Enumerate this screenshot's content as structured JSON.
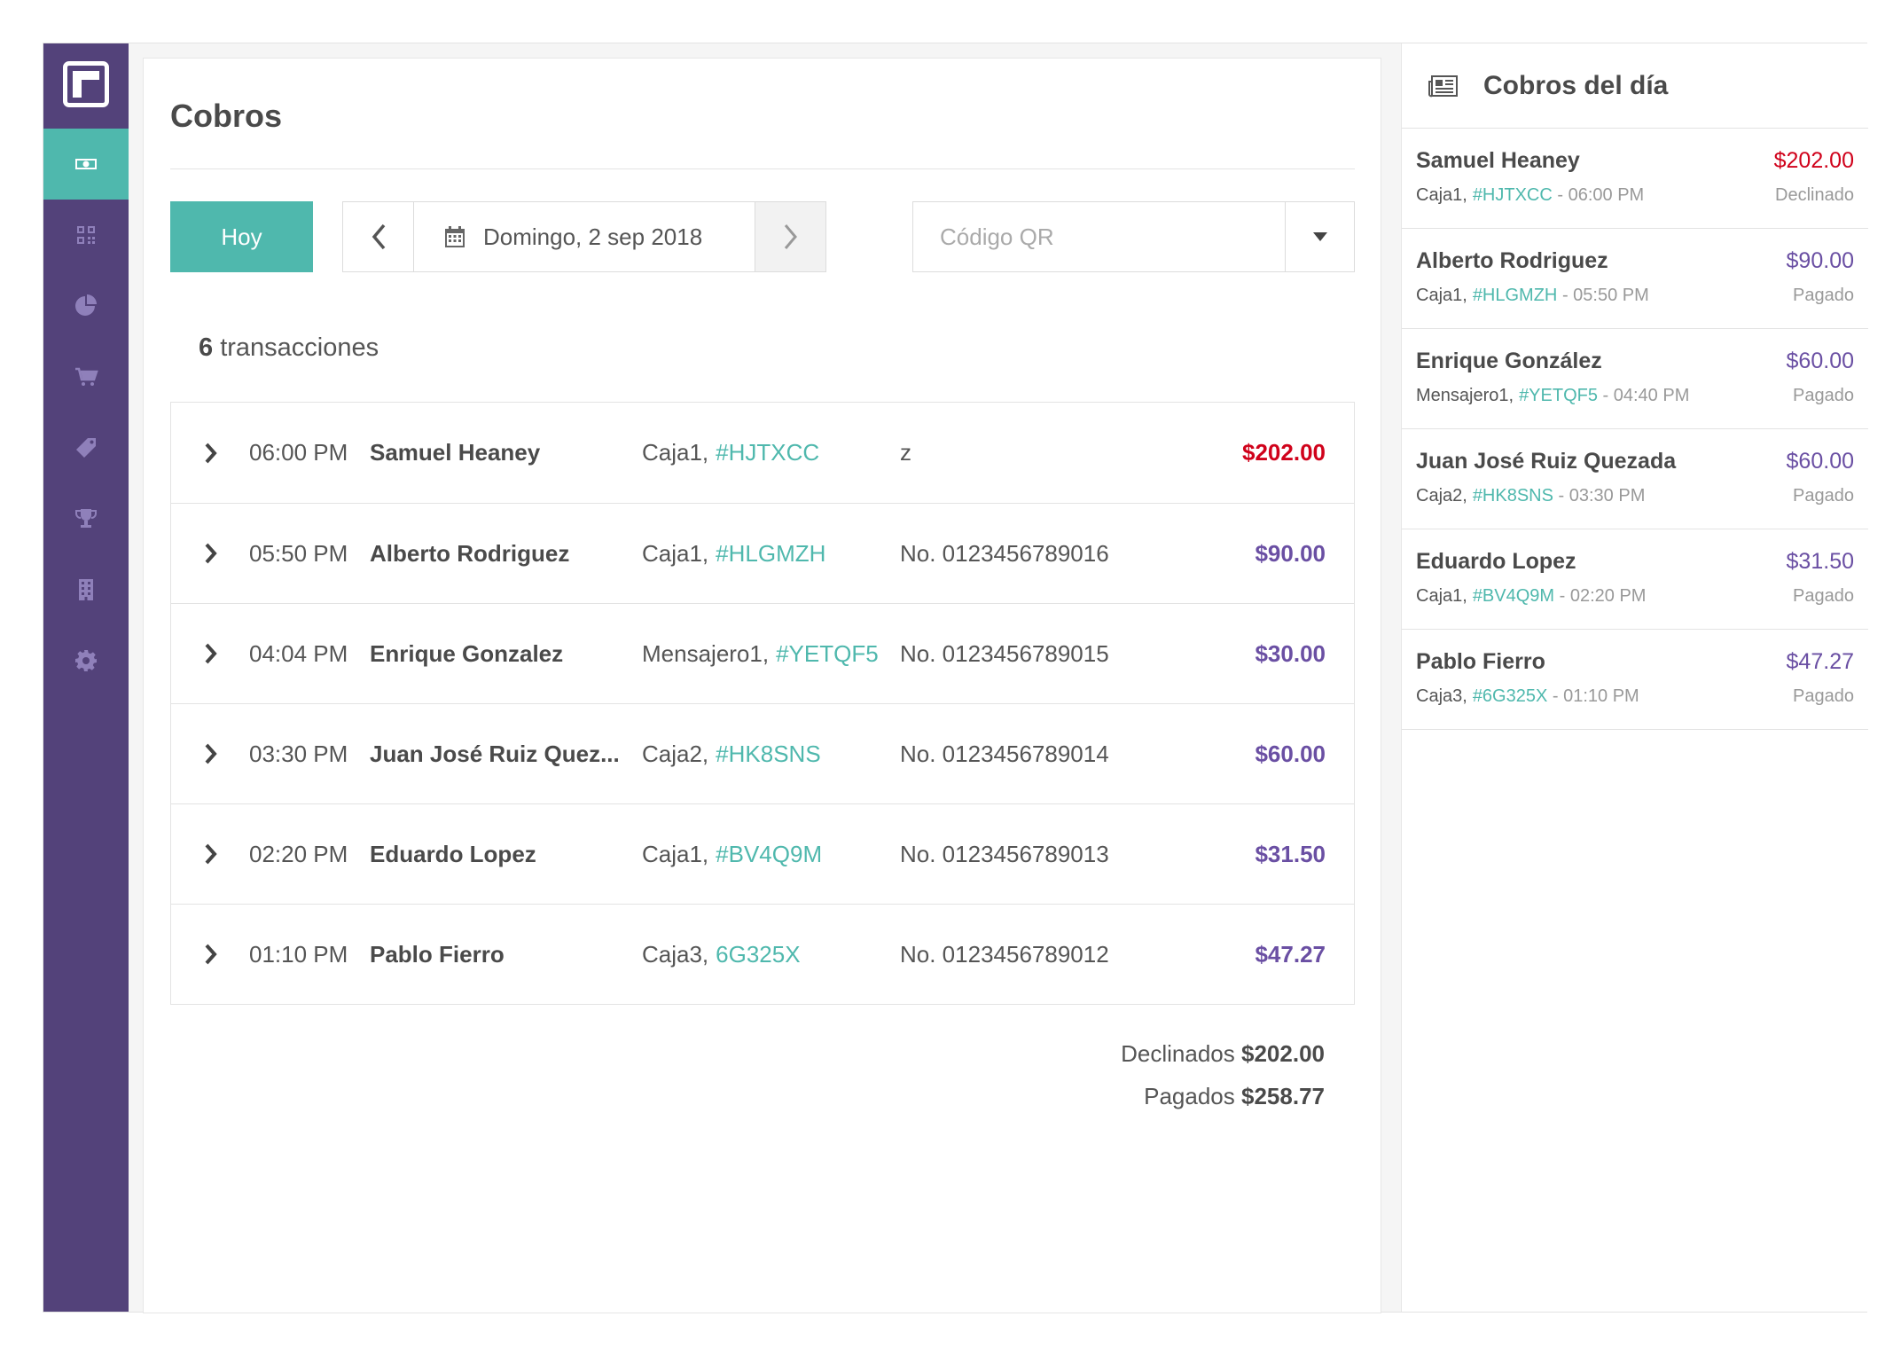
{
  "sidebar": {
    "items": [
      {
        "icon": "money-icon",
        "active": true
      },
      {
        "icon": "qr-code-icon",
        "active": false
      },
      {
        "icon": "pie-chart-icon",
        "active": false
      },
      {
        "icon": "cart-icon",
        "active": false
      },
      {
        "icon": "tag-icon",
        "active": false
      },
      {
        "icon": "trophy-icon",
        "active": false
      },
      {
        "icon": "building-icon",
        "active": false
      },
      {
        "icon": "gear-icon",
        "active": false
      }
    ]
  },
  "main": {
    "title": "Cobros",
    "today_button": "Hoy",
    "date_label": "Domingo, 2 sep 2018",
    "qr_placeholder": "Código QR",
    "tx_count_number": "6",
    "tx_count_label": " transacciones",
    "transactions": [
      {
        "time": "06:00 PM",
        "name": "Samuel Heaney",
        "terminal": "Caja1,",
        "code": "#HJTXCC",
        "ref": "z",
        "amount": "$202.00",
        "status": "declined"
      },
      {
        "time": "05:50 PM",
        "name": "Alberto Rodriguez",
        "terminal": "Caja1,",
        "code": "#HLGMZH",
        "ref": "No. 0123456789016",
        "amount": "$90.00",
        "status": "paid"
      },
      {
        "time": "04:04 PM",
        "name": "Enrique Gonzalez",
        "terminal": "Mensajero1,",
        "code": "#YETQF5",
        "ref": "No. 0123456789015",
        "amount": "$30.00",
        "status": "paid"
      },
      {
        "time": "03:30 PM",
        "name": "Juan José Ruiz Quez...",
        "terminal": "Caja2,",
        "code": "#HK8SNS",
        "ref": "No. 0123456789014",
        "amount": "$60.00",
        "status": "paid"
      },
      {
        "time": "02:20 PM",
        "name": "Eduardo Lopez",
        "terminal": "Caja1,",
        "code": "#BV4Q9M",
        "ref": "No. 0123456789013",
        "amount": "$31.50",
        "status": "paid"
      },
      {
        "time": "01:10 PM",
        "name": "Pablo Fierro",
        "terminal": "Caja3,",
        "code": "6G325X",
        "ref": "No. 0123456789012",
        "amount": "$47.27",
        "status": "paid"
      }
    ],
    "totals": {
      "declined_label": "Declinados",
      "declined_value": "$202.00",
      "paid_label": "Pagados",
      "paid_value": "$258.77"
    }
  },
  "right_panel": {
    "icon": "newspaper-icon",
    "title": "Cobros del día",
    "items": [
      {
        "name": "Samuel Heaney",
        "amount": "$202.00",
        "terminal": "Caja1,",
        "code": "#HJTXCC",
        "time": " - 06:00 PM",
        "status": "Declinado",
        "status_key": "declined"
      },
      {
        "name": "Alberto Rodriguez",
        "amount": "$90.00",
        "terminal": "Caja1,",
        "code": "#HLGMZH",
        "time": " - 05:50 PM",
        "status": "Pagado",
        "status_key": "paid"
      },
      {
        "name": "Enrique González",
        "amount": "$60.00",
        "terminal": "Mensajero1,",
        "code": "#YETQF5",
        "time": " - 04:40 PM",
        "status": "Pagado",
        "status_key": "paid"
      },
      {
        "name": "Juan José Ruiz Quezada",
        "amount": "$60.00",
        "terminal": "Caja2,",
        "code": "#HK8SNS",
        "time": " - 03:30 PM",
        "status": "Pagado",
        "status_key": "paid"
      },
      {
        "name": "Eduardo Lopez",
        "amount": "$31.50",
        "terminal": "Caja1,",
        "code": "#BV4Q9M",
        "time": " - 02:20 PM",
        "status": "Pagado",
        "status_key": "paid"
      },
      {
        "name": "Pablo Fierro",
        "amount": "$47.27",
        "terminal": "Caja3,",
        "code": "#6G325X",
        "time": " - 01:10 PM",
        "status": "Pagado",
        "status_key": "paid"
      }
    ]
  },
  "colors": {
    "sidebar_bg": "#53427a",
    "accent_teal": "#4fb8ad",
    "paid_purple": "#6a4fa3",
    "declined_red": "#d0021b"
  }
}
